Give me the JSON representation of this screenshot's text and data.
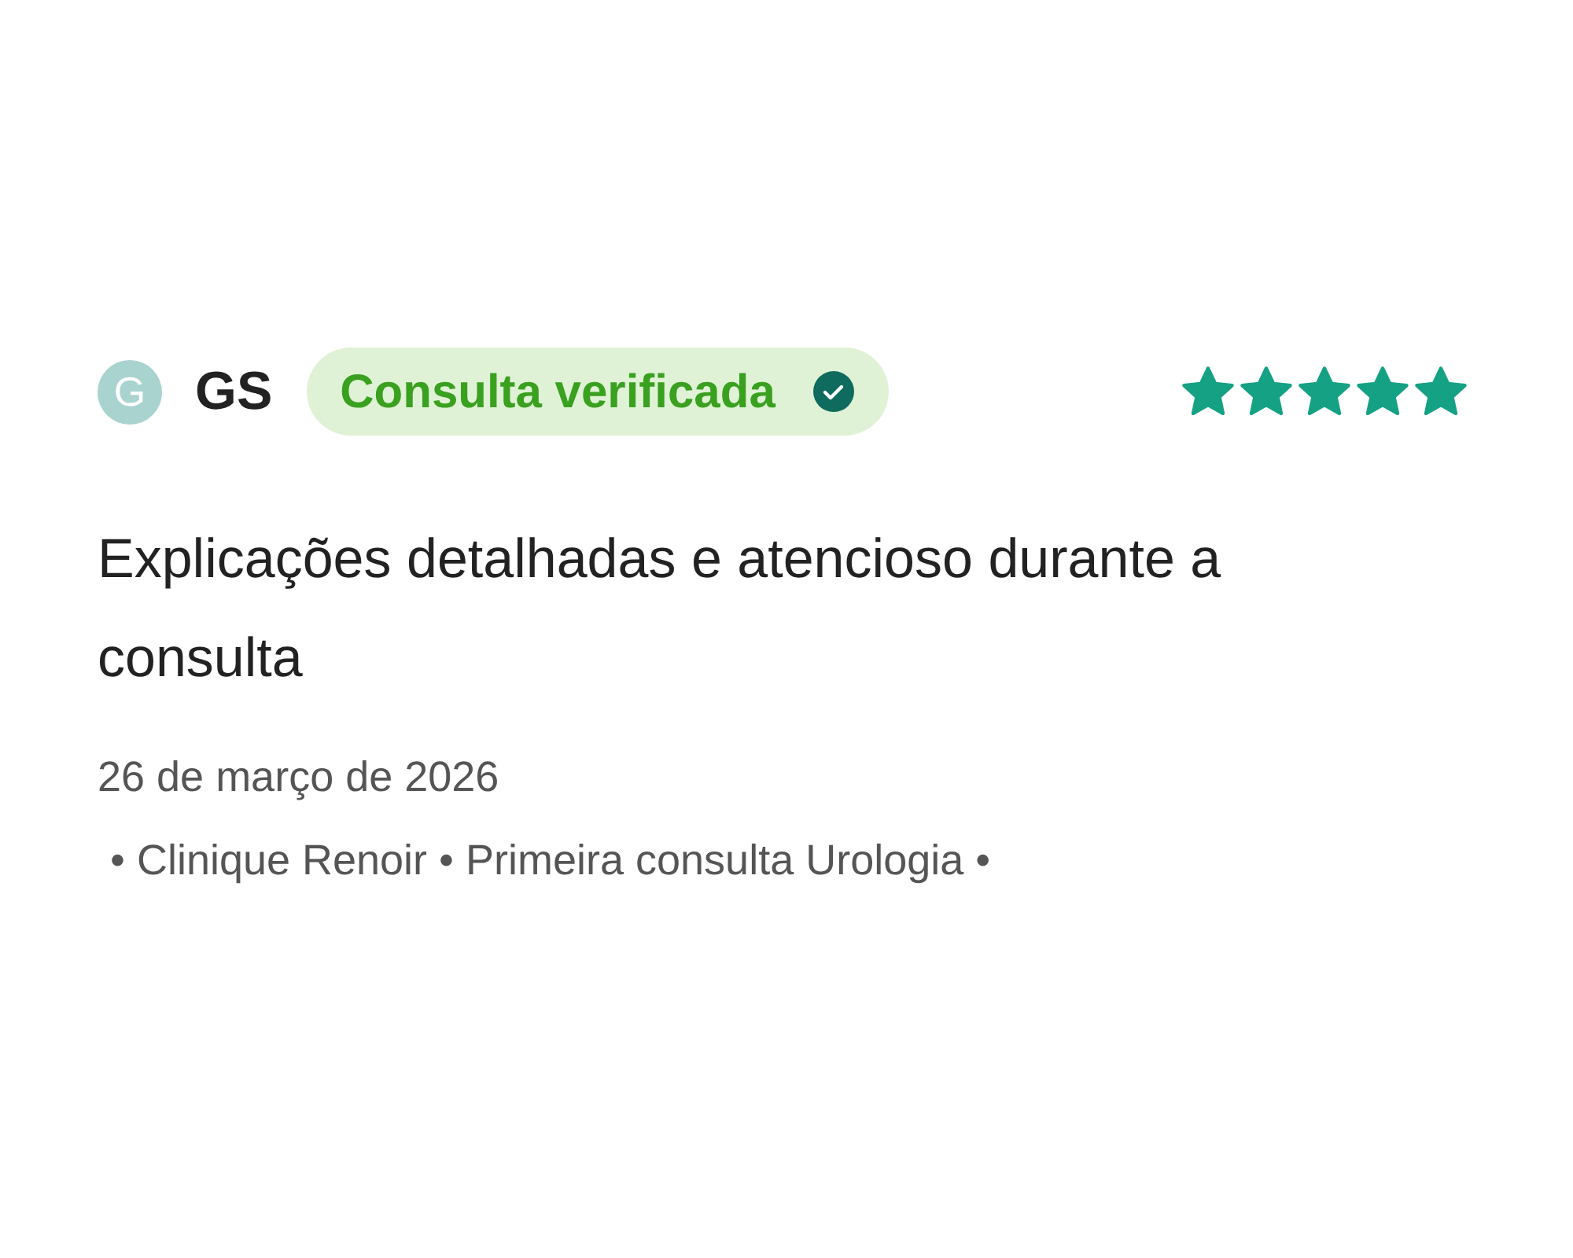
{
  "review": {
    "avatar_initial": "G",
    "author": "GS",
    "badge": "Consulta verificada",
    "stars": 5,
    "title": "Explicações detalhadas e atencioso durante a consulta",
    "date": "26 de março de 2026",
    "details": "• Clinique Renoir • Primeira consulta Urologia •"
  }
}
